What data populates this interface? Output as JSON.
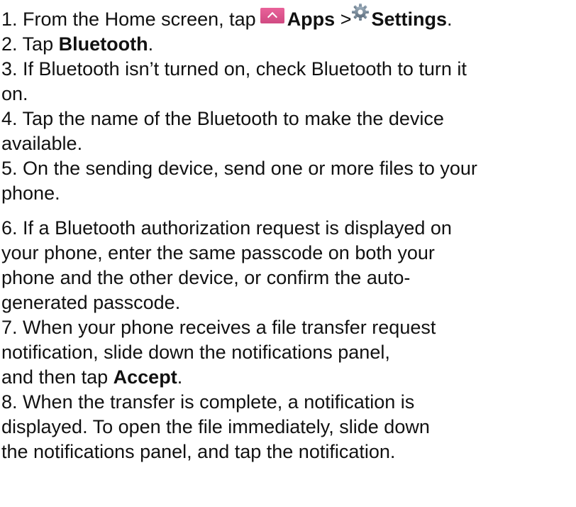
{
  "steps": [
    {
      "number": "1.",
      "pre": "From the Home screen, tap",
      "apps_label": "Apps",
      "separator": ">",
      "settings_label": "Settings",
      "post": "."
    },
    {
      "number": "2.",
      "pre": "Tap",
      "bold": "Bluetooth",
      "post": "."
    },
    {
      "number": "3.",
      "line1": "If Bluetooth isn’t turned on, check Bluetooth to turn it",
      "line2": "on."
    },
    {
      "number": "4.",
      "line1": "Tap the name of the Bluetooth to make the device",
      "line2": "available."
    },
    {
      "number": "5.",
      "line1": "On the sending device, send one or more files to your",
      "line2": "phone."
    },
    {
      "number": "6.",
      "line1": "If a Bluetooth authorization request is displayed on",
      "line2": "your phone, enter the same passcode on both your",
      "line3": "phone and the other device, or confirm the auto-",
      "line4": "generated passcode."
    },
    {
      "number": "7.",
      "line1": "When your phone receives a file transfer request",
      "line2": "notification, slide down the notifications panel,",
      "line3_pre": "and then tap",
      "line3_bold": "Accept",
      "line3_post": "."
    },
    {
      "number": "8.",
      "line1": "When the transfer is complete, a notification is",
      "line2": "displayed. To open the file immediately, slide down",
      "line3": "the notifications panel, and tap the notification."
    }
  ],
  "icons": {
    "apps": "apps-icon",
    "settings": "gear-icon",
    "apps_color": "#e0598f",
    "settings_color": "#7a8a99"
  }
}
